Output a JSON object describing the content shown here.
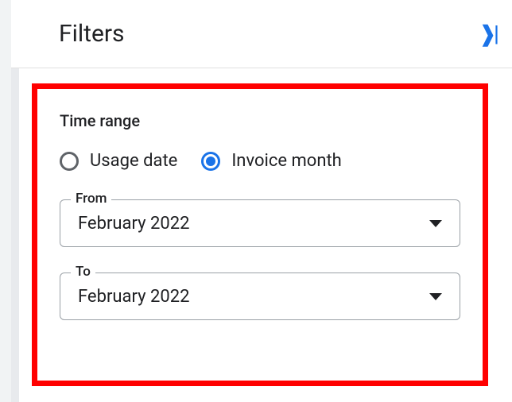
{
  "header": {
    "title": "Filters"
  },
  "timeRange": {
    "sectionTitle": "Time range",
    "options": {
      "usageDate": "Usage date",
      "invoiceMonth": "Invoice month"
    },
    "from": {
      "label": "From",
      "value": "February 2022"
    },
    "to": {
      "label": "To",
      "value": "February 2022"
    },
    "selected": "invoiceMonth"
  }
}
